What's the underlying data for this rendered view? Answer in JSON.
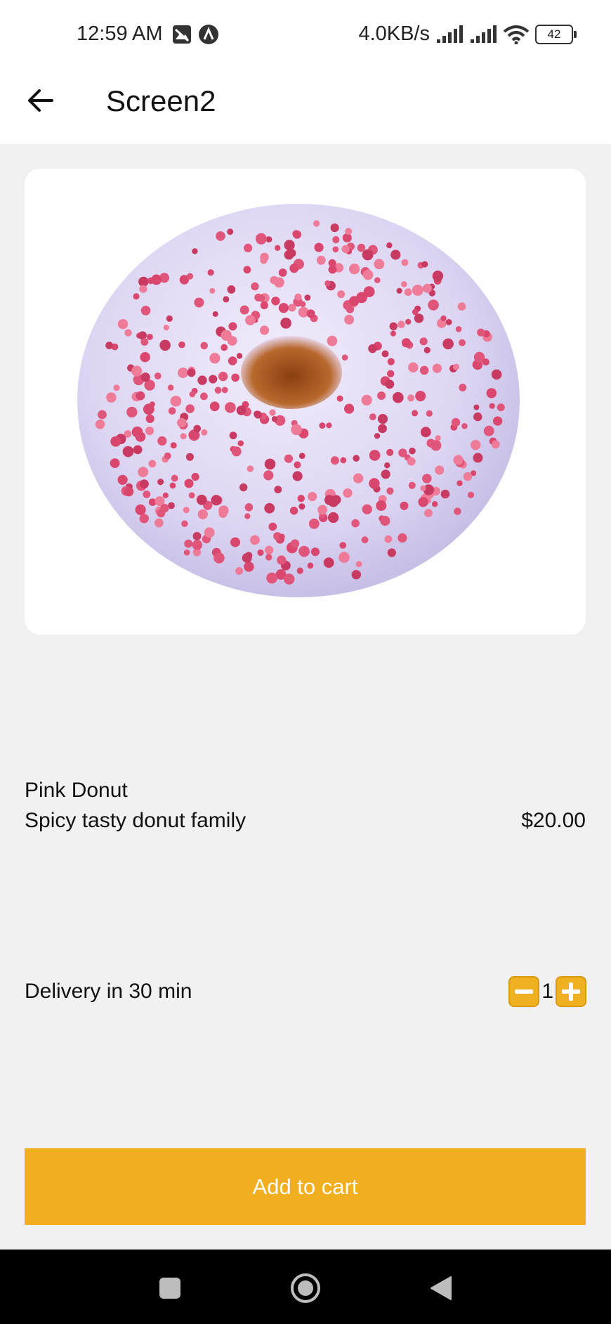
{
  "status_bar": {
    "time": "12:59 AM",
    "network_speed": "4.0KB/s",
    "battery_level": "42",
    "icons": [
      "photo-icon",
      "app-a-icon",
      "signal-icon",
      "signal-icon",
      "wifi-icon",
      "battery-icon"
    ]
  },
  "app_bar": {
    "back_icon": "arrow-left-icon",
    "title": "Screen2"
  },
  "product": {
    "image_subject": "pink sprinkled donut",
    "name": "Pink Donut",
    "description": "Spicy tasty donut family",
    "price": "$20.00",
    "delivery": "Delivery in 30 min",
    "quantity": "1"
  },
  "actions": {
    "add_to_cart_label": "Add to cart",
    "minus_icon": "minus-icon",
    "plus_icon": "plus-icon"
  },
  "nav_bar": {
    "icons": [
      "recents-square-icon",
      "home-circle-icon",
      "back-triangle-icon"
    ]
  },
  "colors": {
    "accent": "#f1ae1f",
    "background": "#f1f1f1",
    "surface": "#ffffff",
    "navbar": "#000000"
  }
}
